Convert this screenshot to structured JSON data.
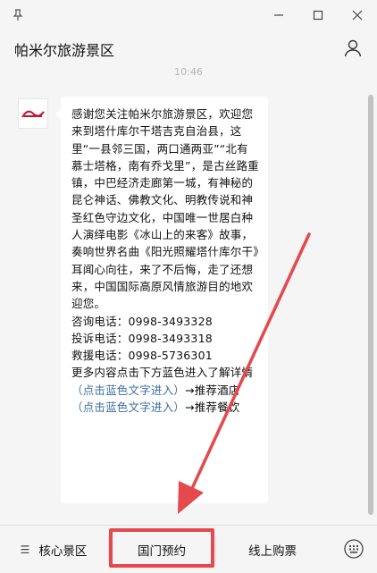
{
  "window": {
    "pin_icon": "pin-icon",
    "minimize_icon": "minimize-icon",
    "maximize_icon": "maximize-icon",
    "close_icon": "close-icon"
  },
  "header": {
    "title": "帕米尔旅游景区",
    "profile_icon": "person-icon"
  },
  "timestamp": "10:46",
  "message": {
    "intro": "感谢您关注帕米尔旅游景区，欢迎您来到塔什库尔干塔吉克自治县，这里“一县邻三国，两口通两亚”“北有慕士塔格，南有乔戈里”，是古丝路重镇，中巴经济走廊第一城，有神秘的昆仑神话、佛教文化、明教传说和神圣红色守边文化，中国唯一世居白种人演绎电影《冰山上的来客》故事，奏响世界名曲《阳光照耀塔什库尔干》耳闻心向往，来了不后悔，走了还想来，中国国际高原风情旅游目的地欢迎您。",
    "consult": "咨询电话：0998-3493328",
    "complaint": "投诉电话：0998-3493318",
    "rescue": "救援电话：0998-5736301",
    "more": "更多内容点击下方蓝色进入了解详情",
    "link1": "（点击蓝色文字进入）",
    "link1_suffix": "→推荐酒店",
    "link2": "（点击蓝色文字进入）",
    "link2_suffix": "→推荐餐饮"
  },
  "bottom_menu": {
    "item1": "核心景区",
    "item2": "国门预约",
    "item3": "线上购票",
    "menu_icon": "hamburger-icon",
    "keyboard_icon": "keyboard-icon"
  },
  "colors": {
    "annotation_red": "#e5484d",
    "link_blue": "#3a6ea5"
  }
}
